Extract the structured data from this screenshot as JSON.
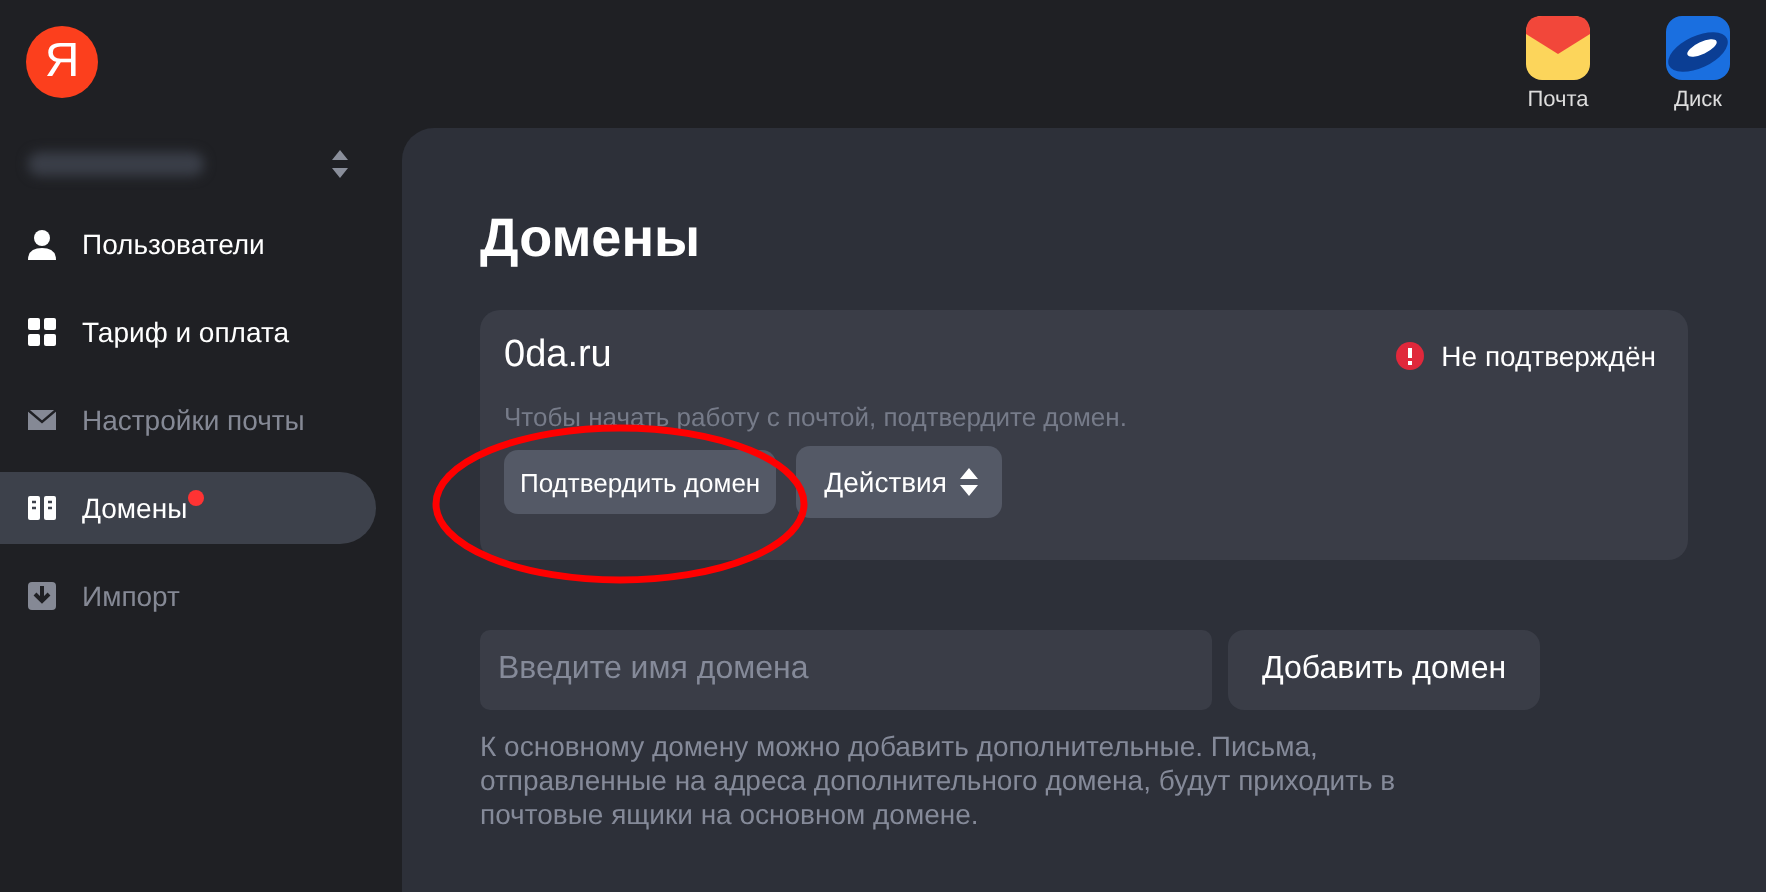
{
  "logo": {
    "letter": "Я"
  },
  "apps": [
    {
      "kind": "mail",
      "label": "Почта"
    },
    {
      "kind": "disk",
      "label": "Диск"
    }
  ],
  "sidebar": {
    "items": [
      {
        "kind": "user",
        "label": "Пользователи",
        "selected": false,
        "disabled": false,
        "badge": false
      },
      {
        "kind": "grid",
        "label": "Тариф и оплата",
        "selected": false,
        "disabled": false,
        "badge": false
      },
      {
        "kind": "mail",
        "label": "Настройки почты",
        "selected": false,
        "disabled": true,
        "badge": false
      },
      {
        "kind": "domains",
        "label": "Домены",
        "selected": true,
        "disabled": false,
        "badge": true
      },
      {
        "kind": "import",
        "label": "Импорт",
        "selected": false,
        "disabled": true,
        "badge": false
      }
    ]
  },
  "page": {
    "title": "Домены",
    "domain_card": {
      "name": "0da.ru",
      "status": "Не подтверждён",
      "hint": "Чтобы начать работу с почтой, подтвердите домен.",
      "confirm_button": "Подтвердить домен",
      "actions_button": "Действия"
    },
    "add_domain": {
      "placeholder": "Введите имя домена",
      "button": "Добавить домен",
      "note": "К основному домену можно добавить дополнительные. Письма, отправленные на адреса дополнительного домена, будут приходить в почтовые ящики на основном домене."
    }
  }
}
